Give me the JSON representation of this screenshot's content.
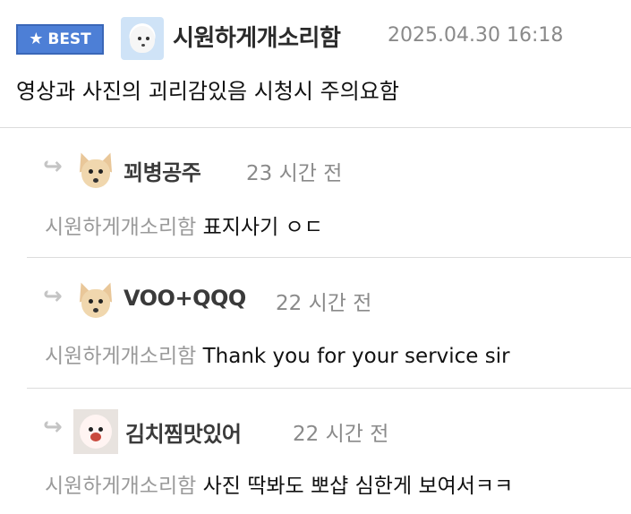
{
  "best_comment": {
    "badge": "BEST",
    "author": "시원하게개소리함",
    "timestamp": "2025.04.30 16:18",
    "text": "영상과 사진의 괴리감있음 시청시 주의요함"
  },
  "replies": [
    {
      "author": "꾀병공주",
      "time": "23 시간 전",
      "mention": "시원하게개소리함",
      "text": "표지사기 ㅇㄷ",
      "avatar": "chihuahua-avatar"
    },
    {
      "author": "VOO+QQQ",
      "time": "22 시간 전",
      "mention": "시원하게개소리함",
      "text": "Thank you for your service sir",
      "avatar": "chihuahua-avatar"
    },
    {
      "author": "김치찜맛있어",
      "time": "22 시간 전",
      "mention": "시원하게개소리함",
      "text": "사진 딱봐도 뽀샵 심한게 보여서ㅋㅋ",
      "avatar": "dog-avatar"
    }
  ],
  "colors": {
    "badge": "#4d7fd6",
    "muted": "#8a8a8a",
    "divider": "#dcdcdc"
  },
  "icons": {
    "badge": "star-icon",
    "reply": "reply-arrow-icon"
  }
}
